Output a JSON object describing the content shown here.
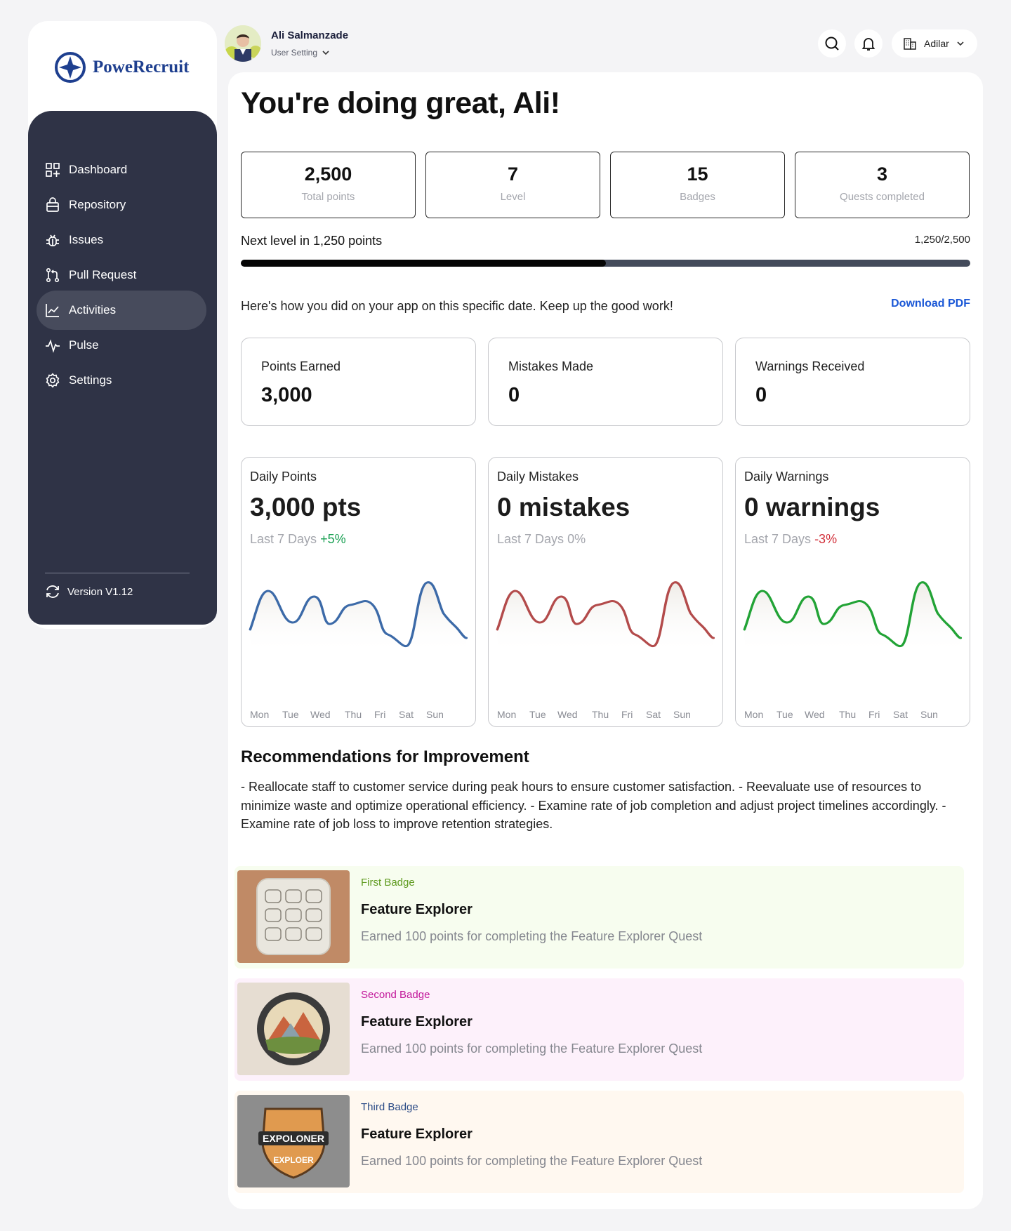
{
  "brand": {
    "name": "PoweRecruit",
    "color": "#1e3f8f"
  },
  "user": {
    "name": "Ali Salmanzade",
    "setting_label": "User Setting"
  },
  "header": {
    "org_label": "Adilar"
  },
  "nav": {
    "items": [
      {
        "label": "Dashboard",
        "icon": "dashboard-icon"
      },
      {
        "label": "Repository",
        "icon": "repository-icon"
      },
      {
        "label": "Issues",
        "icon": "bug-icon"
      },
      {
        "label": "Pull Request",
        "icon": "pull-request-icon"
      },
      {
        "label": "Activities",
        "icon": "activity-chart-icon",
        "active": true
      },
      {
        "label": "Pulse",
        "icon": "pulse-icon"
      },
      {
        "label": "Settings",
        "icon": "gear-icon"
      }
    ],
    "version": "Version V1.12"
  },
  "main": {
    "greeting": "You're doing great, Ali!",
    "stats": [
      {
        "value": "2,500",
        "label": "Total points"
      },
      {
        "value": "7",
        "label": "Level"
      },
      {
        "value": "15",
        "label": "Badges"
      },
      {
        "value": "3",
        "label": "Quests completed"
      }
    ],
    "next_level": "Next level in 1,250 points",
    "progress_text": "1,250/2,500",
    "progress_fraction": 0.5,
    "intro": "Here's how you did on your app on this specific date. Keep up the good work!",
    "download_label": "Download PDF",
    "summary": [
      {
        "label": "Points Earned",
        "value": "3,000"
      },
      {
        "label": "Mistakes Made",
        "value": "0"
      },
      {
        "label": "Warnings Received",
        "value": "0"
      }
    ],
    "charts": [
      {
        "title": "Daily Points",
        "value": "3,000 pts",
        "period": "Last 7 Days",
        "change": "+5%",
        "color": "#3c6aa8"
      },
      {
        "title": "Daily Mistakes",
        "value": "0 mistakes",
        "period": "Last 7 Days",
        "change": "0%",
        "color": "#b34b4b"
      },
      {
        "title": "Daily Warnings",
        "value": "0 warnings",
        "period": "Last 7 Days",
        "change": "-3%",
        "color": "#22a336"
      }
    ],
    "days": [
      "Mon",
      "Tue",
      "Wed",
      "Thu",
      "Fri",
      "Sat",
      "Sun"
    ],
    "recommendations_title": "Recommendations for Improvement",
    "recommendations_text": "- Reallocate staff to customer service during peak hours to ensure customer satisfaction. - Reevaluate use of resources to minimize waste and optimize operational efficiency. - Examine rate of job completion and adjust project timelines accordingly. - Examine rate of job loss to improve retention strategies.",
    "badges": [
      {
        "kicker": "First Badge",
        "name": "Feature Explorer",
        "desc": "Earned 100 points for completing the Feature Explorer Quest",
        "kicker_color": "#5e9a1e",
        "bg": "#f7fdef"
      },
      {
        "kicker": "Second Badge",
        "name": "Feature Explorer",
        "desc": "Earned 100 points for completing the Feature Explorer Quest",
        "kicker_color": "#c2189a",
        "bg": "#fdf1fb"
      },
      {
        "kicker": "Third Badge",
        "name": "Feature Explorer",
        "desc": "Earned 100 points for completing the Feature Explorer Quest",
        "kicker_color": "#2a4a86",
        "bg": "#fff8f0"
      }
    ],
    "badge_art_text": {
      "third_top": "EXPOLONER",
      "third_bottom": "EXPLOER"
    }
  }
}
